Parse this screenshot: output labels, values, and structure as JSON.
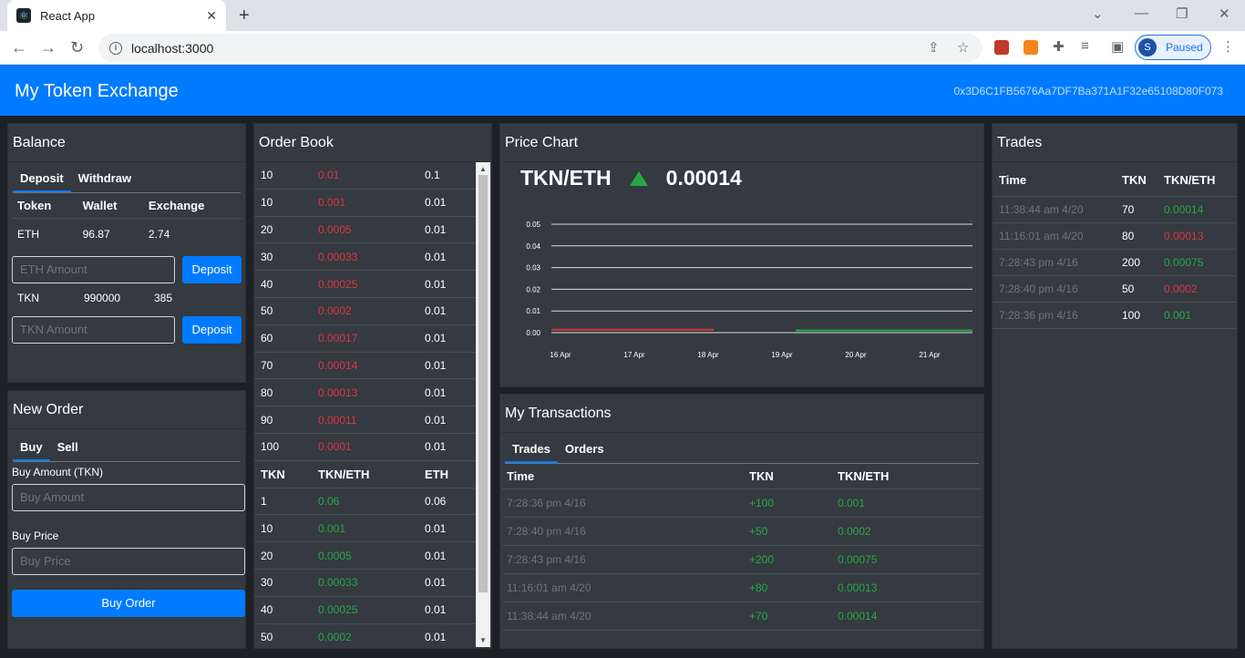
{
  "browser": {
    "tab_title": "React App",
    "url": "localhost:3000",
    "profile_initial": "S",
    "profile_label": "Paused"
  },
  "app": {
    "brand": "My Token Exchange",
    "account": "0x3D6C1FB5676Aa7DF7Ba371A1F32e65108D80F073"
  },
  "balance": {
    "title": "Balance",
    "tabs": [
      "Deposit",
      "Withdraw"
    ],
    "headers": [
      "Token",
      "Wallet",
      "Exchange"
    ],
    "eth": {
      "token": "ETH",
      "wallet": "96.87",
      "exchange": "2.74",
      "placeholder": "ETH Amount",
      "button": "Deposit"
    },
    "tkn": {
      "token": "TKN",
      "wallet": "990000",
      "exchange": "385",
      "placeholder": "TKN Amount",
      "button": "Deposit"
    }
  },
  "new_order": {
    "title": "New Order",
    "tabs": [
      "Buy",
      "Sell"
    ],
    "amount_label": "Buy Amount (TKN)",
    "amount_placeholder": "Buy Amount",
    "price_label": "Buy Price",
    "price_placeholder": "Buy Price",
    "button": "Buy Order"
  },
  "order_book": {
    "title": "Order Book",
    "sell_orders": [
      [
        "10",
        "0.01",
        "0.1"
      ],
      [
        "10",
        "0.001",
        "0.01"
      ],
      [
        "20",
        "0.0005",
        "0.01"
      ],
      [
        "30",
        "0.00033",
        "0.01"
      ],
      [
        "40",
        "0.00025",
        "0.01"
      ],
      [
        "50",
        "0.0002",
        "0.01"
      ],
      [
        "60",
        "0.00017",
        "0.01"
      ],
      [
        "70",
        "0.00014",
        "0.01"
      ],
      [
        "80",
        "0.00013",
        "0.01"
      ],
      [
        "90",
        "0.00011",
        "0.01"
      ],
      [
        "100",
        "0.0001",
        "0.01"
      ]
    ],
    "headers": [
      "TKN",
      "TKN/ETH",
      "ETH"
    ],
    "buy_orders": [
      [
        "1",
        "0.06",
        "0.06"
      ],
      [
        "10",
        "0.001",
        "0.01"
      ],
      [
        "20",
        "0.0005",
        "0.01"
      ],
      [
        "30",
        "0.00033",
        "0.01"
      ],
      [
        "40",
        "0.00025",
        "0.01"
      ],
      [
        "50",
        "0.0002",
        "0.01"
      ]
    ]
  },
  "price_chart": {
    "title": "Price Chart",
    "pair": "TKN/ETH",
    "price": "0.00014",
    "trend_color": "#28a745"
  },
  "chart_data": {
    "type": "line",
    "y_ticks": [
      "0.05",
      "0.04",
      "0.03",
      "0.02",
      "0.01",
      "0.00"
    ],
    "x_ticks": [
      "16 Apr",
      "17 Apr",
      "18 Apr",
      "19 Apr",
      "20 Apr",
      "21 Apr"
    ],
    "ylim": [
      0,
      0.05
    ],
    "grid": true,
    "segments": [
      {
        "color": "#dc3545",
        "x": [
          "16 Apr",
          "18 Apr"
        ],
        "values": [
          0.0005,
          0.0005
        ]
      },
      {
        "color": "#28a745",
        "x": [
          "19 Apr",
          "21 Apr"
        ],
        "values": [
          0.00014,
          0.00014
        ]
      }
    ]
  },
  "my_transactions": {
    "title": "My Transactions",
    "tabs": [
      "Trades",
      "Orders"
    ],
    "headers": [
      "Time",
      "TKN",
      "TKN/ETH"
    ],
    "rows": [
      [
        "7:28:36 pm 4/16",
        "+100",
        "0.001"
      ],
      [
        "7:28:40 pm 4/16",
        "+50",
        "0.0002"
      ],
      [
        "7:28:43 pm 4/16",
        "+200",
        "0.00075"
      ],
      [
        "11:16:01 am 4/20",
        "+80",
        "0.00013"
      ],
      [
        "11:38:44 am 4/20",
        "+70",
        "0.00014"
      ]
    ]
  },
  "trades": {
    "title": "Trades",
    "headers": [
      "Time",
      "TKN",
      "TKN/ETH"
    ],
    "rows": [
      {
        "time": "11:38:44 am 4/20",
        "tkn": "70",
        "price": "0.00014",
        "color": "green"
      },
      {
        "time": "11:16:01 am 4/20",
        "tkn": "80",
        "price": "0.00013",
        "color": "red"
      },
      {
        "time": "7:28:43 pm 4/16",
        "tkn": "200",
        "price": "0.00075",
        "color": "green"
      },
      {
        "time": "7:28:40 pm 4/16",
        "tkn": "50",
        "price": "0.0002",
        "color": "red"
      },
      {
        "time": "7:28:36 pm 4/16",
        "tkn": "100",
        "price": "0.001",
        "color": "green"
      }
    ]
  }
}
